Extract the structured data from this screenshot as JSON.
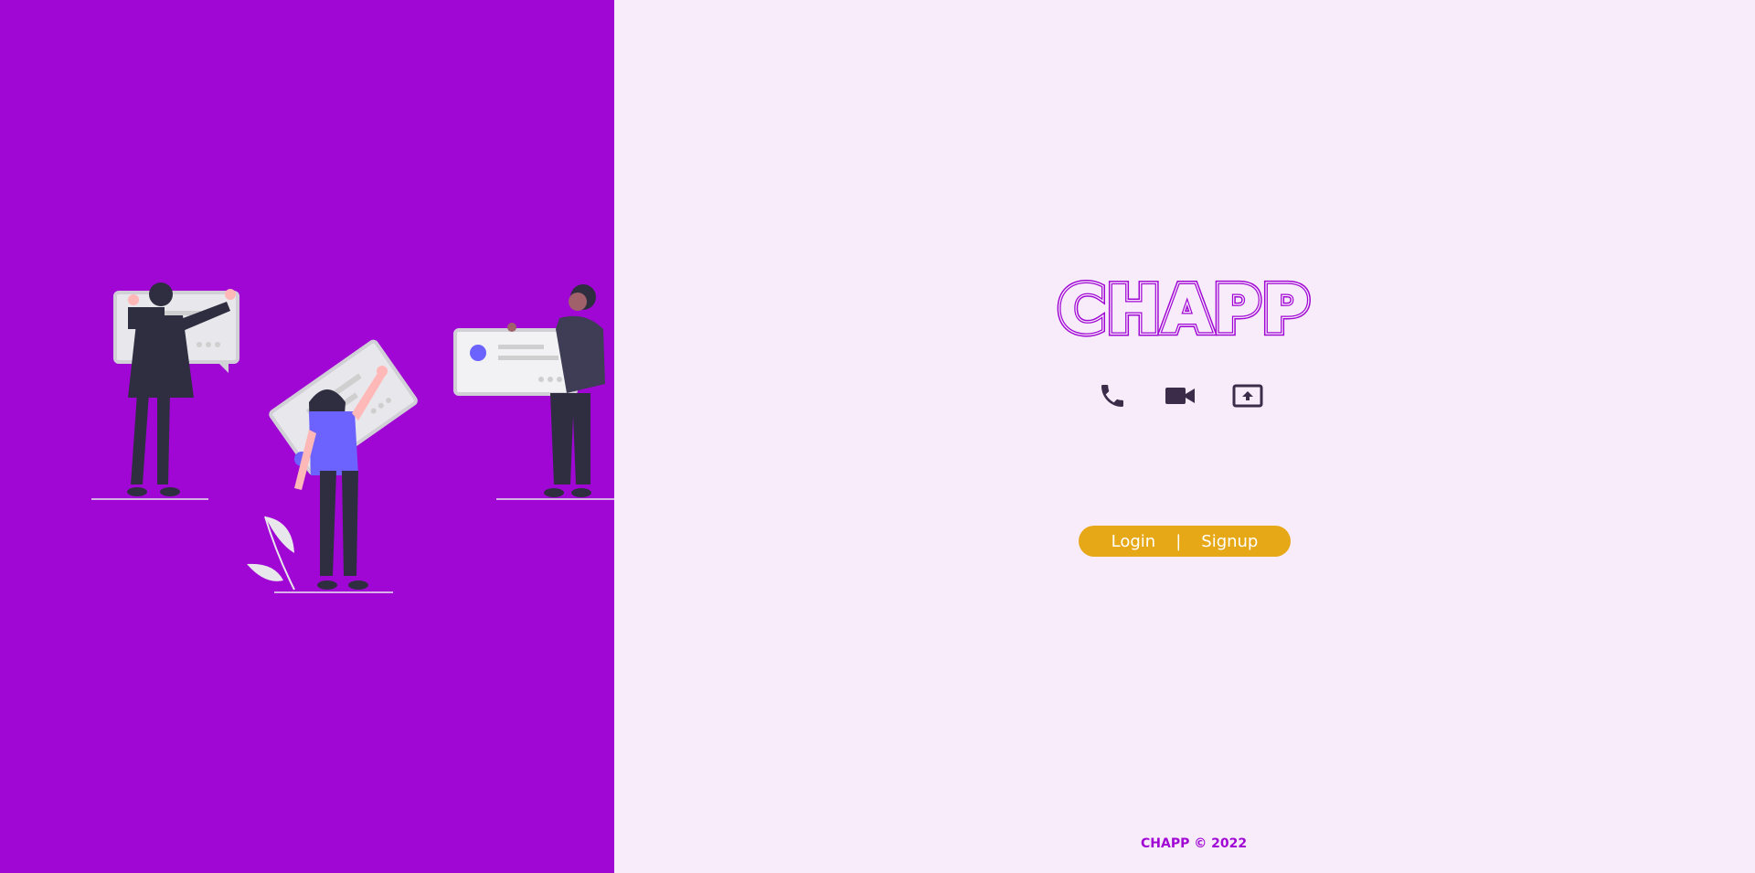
{
  "brand": {
    "logo_text": "CHAPP",
    "logo_color": "#a007d4"
  },
  "features": [
    {
      "icon": "phone-icon"
    },
    {
      "icon": "video-camera-icon"
    },
    {
      "icon": "screen-share-icon"
    }
  ],
  "auth": {
    "login_label": "Login",
    "separator": "|",
    "signup_label": "Signup",
    "button_color": "#e6a817"
  },
  "footer": {
    "text": "CHAPP © 2022"
  },
  "colors": {
    "left_panel": "#a007d4",
    "right_panel": "#f8ecfa",
    "icon_color": "#3b2d4a"
  }
}
